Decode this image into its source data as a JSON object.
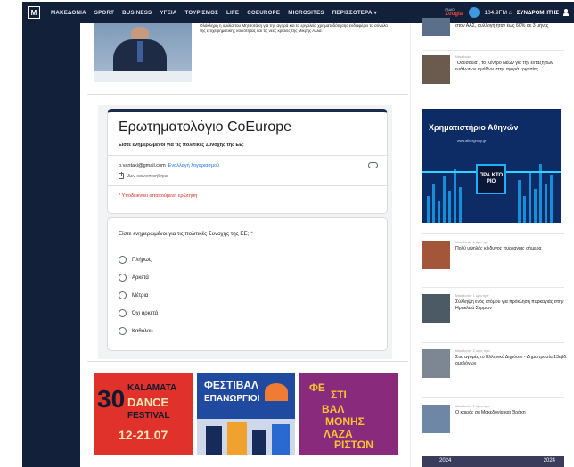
{
  "nav": {
    "logo": "M",
    "items": [
      "ΜΑΚΕΔΟΝΙΑ",
      "SPORT",
      "BUSINESS",
      "ΥΓΕΙΑ",
      "ΤΟΥΡΙΣΜΟΣ",
      "LIFE",
      "COEUROPE",
      "MICROSITES",
      "ΠΕΡΙΣΣΟΤΕΡΑ ▾"
    ],
    "radio_line1": "ΡΑΔΙΟ",
    "radio_line2": "Zougla",
    "frequency": "104.9FM ⌂",
    "login": "ΣΥΝΔΡΟΜΗΤΗΣ"
  },
  "article": {
    "text": "Ολόκληρη η ομιλία του Μητσοτάκη για την αγορά και τα εργαλεία χρηματοδότησης ενδιαφέρει το σύνολο της επιχειρηματικής κοινότητας και τις νέες κρίσεις της Μικρής Αλλά."
  },
  "form": {
    "title": "Ερωτηματολόγιο CoEurope",
    "subtitle": "Είστε ενημερωμένοι για τις πολιτικές Συνοχής της ΕΕ;",
    "email": "p.vantaki@gmail.com",
    "switch_account": "Εναλλαγή λογαριασμού",
    "not_saved": "Δεν κοινοποιήθηκε",
    "required_note": "* Υποδεικνύει απαιτούμενη ερώτηση",
    "question": "Είστε ενημερωμένοι για τις πολιτικές Συνοχής της ΕΕ;",
    "required_star": "*",
    "options": [
      "Πλήρως",
      "Αρκετά",
      "Μέτρια",
      "Όχι αρκετά",
      "Καθόλου"
    ]
  },
  "banners": {
    "kalamata": {
      "num": "30",
      "l1": "KALAMATA",
      "l2": "DANCE",
      "l3": "FESTIVAL",
      "dates": "12-21.07"
    },
    "karpathos": {
      "l1": "ΦΕΣΤΙΒΑΛ",
      "l2": "ΕΠΑΝΩΡΓΙΟΙ",
      "l3": "ΦΕΣΤΙΒΑΛ"
    },
    "lazaristes": {
      "w1": "ΦΕ",
      "w2": "ΣΤΙ",
      "w3": "ΒΑΛ",
      "w4": "ΜΟΝΗΣ",
      "w5": "ΛΑΖΑ",
      "w6": "ΡΙΣΤΩΝ"
    }
  },
  "sidebar": {
    "top_item": {
      "meta": "",
      "title": "στον ΑΑΣ, συλλογή ήταν έως 60% σε 3 μήνες"
    },
    "item2": {
      "meta": "Μακεδονία",
      "title": "\"Οδύσσεια\", το Κέντρο Νέων για την ένταξη των ευάλωτων ομάδων στην αγορά εργασίας"
    },
    "ad": {
      "title": "Χρηματιστήριο Αθηνών",
      "url": "www.athexgroup.gr",
      "logo": "ΠΡΑ ΚΤΟ ΡΙΟ"
    },
    "items": [
      {
        "meta": "Μακεδονία · 1 ώρα πριν",
        "title": "Πολύ υψηλός κίνδυνος πυρκαγιάς σήμερα"
      },
      {
        "meta": "Μακεδονία · 1 ώρα πριν",
        "title": "Σύλληψη ενός ατόμου για πρόκληση πυρκαγιάς στην Ηρακλειά Σερρών"
      },
      {
        "meta": "Μακεδονία · 2 ώρες πριν",
        "title": "Στις αγορές το Ελληνικό Δημόσιο - Δημοπρασία 13εβδ. ομολόγων"
      },
      {
        "meta": "Μακεδονία · 2 ώρες πριν",
        "title": "Ο καιρός σε Μακεδονία και Θράκη"
      }
    ],
    "ribbon_left": "2024",
    "ribbon_right": "2024"
  }
}
